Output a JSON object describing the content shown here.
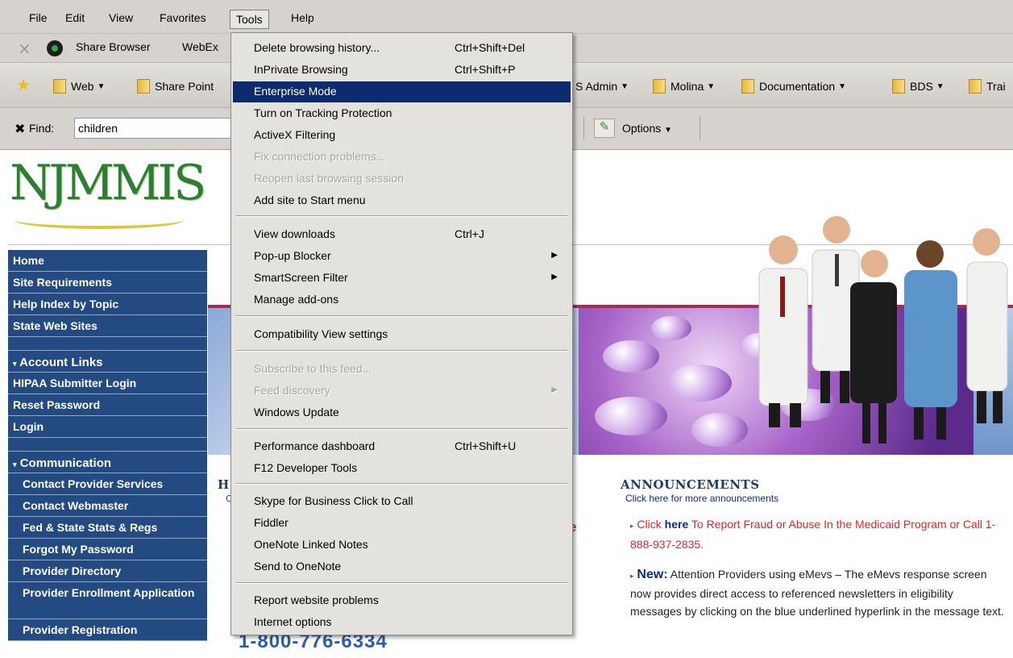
{
  "menubar": {
    "items": [
      "File",
      "Edit",
      "View",
      "Favorites",
      "Tools",
      "Help"
    ]
  },
  "toolbar1": {
    "share_browser": "Share Browser",
    "webex": "WebEx"
  },
  "favorites": {
    "web": "Web",
    "sharepoint": "Share Point",
    "s_admin": "S Admin",
    "molina": "Molina",
    "documentation": "Documentation",
    "bds": "BDS",
    "trai": "Trai"
  },
  "findbar": {
    "label": "Find:",
    "value": "children",
    "options": "Options"
  },
  "logo": {
    "text": "NJMMIS"
  },
  "leftnav": {
    "top_items": [
      "Home",
      "Site Requirements",
      "Help Index by Topic",
      "State Web Sites"
    ],
    "account_header": "Account Links",
    "account_items": [
      "HIPAA Submitter Login",
      "Reset Password",
      "Login"
    ],
    "communication_header": "Communication",
    "communication_items": [
      "Contact Provider Services",
      "Contact Webmaster",
      "Fed & State Stats & Regs",
      "Forgot My Password",
      "Provider Directory",
      "Provider Enrollment Application",
      "Provider Registration"
    ]
  },
  "content": {
    "mid_heading": "H",
    "mid_sub": "C",
    "mid_red": "e",
    "phone": "1-800-776-6334"
  },
  "announcements": {
    "title": "ANNOUNCEMENTS",
    "sub": "Click here for more announcements",
    "fraud_click": "Click",
    "fraud_here": "here",
    "fraud_text": "To Report Fraud or Abuse In the Medicaid Program or Call 1-888-937-2835.",
    "new_label": "New:",
    "new_text": "Attention Providers using eMevs – The eMevs response screen now provides direct access to referenced newsletters in eligibility messages by clicking on the blue underlined hyperlink in the message text."
  },
  "tools_menu": {
    "items": [
      {
        "label": "Delete browsing history...",
        "shortcut": "Ctrl+Shift+Del"
      },
      {
        "label": "InPrivate Browsing",
        "shortcut": "Ctrl+Shift+P"
      },
      {
        "label": "Enterprise Mode",
        "shortcut": ""
      },
      {
        "label": "Turn on Tracking Protection",
        "shortcut": ""
      },
      {
        "label": "ActiveX Filtering",
        "shortcut": ""
      },
      {
        "label": "Fix connection problems...",
        "shortcut": ""
      },
      {
        "label": "Reopen last browsing session",
        "shortcut": ""
      },
      {
        "label": "Add site to Start menu",
        "shortcut": ""
      },
      {
        "label": "View downloads",
        "shortcut": "Ctrl+J"
      },
      {
        "label": "Pop-up Blocker",
        "shortcut": ""
      },
      {
        "label": "SmartScreen Filter",
        "shortcut": ""
      },
      {
        "label": "Manage add-ons",
        "shortcut": ""
      },
      {
        "label": "Compatibility View settings",
        "shortcut": ""
      },
      {
        "label": "Subscribe to this feed...",
        "shortcut": ""
      },
      {
        "label": "Feed discovery",
        "shortcut": ""
      },
      {
        "label": "Windows Update",
        "shortcut": ""
      },
      {
        "label": "Performance dashboard",
        "shortcut": "Ctrl+Shift+U"
      },
      {
        "label": "F12 Developer Tools",
        "shortcut": ""
      },
      {
        "label": "Skype for Business Click to Call",
        "shortcut": ""
      },
      {
        "label": "Fiddler",
        "shortcut": ""
      },
      {
        "label": "OneNote Linked Notes",
        "shortcut": ""
      },
      {
        "label": "Send to OneNote",
        "shortcut": ""
      },
      {
        "label": "Report website problems",
        "shortcut": ""
      },
      {
        "label": "Internet options",
        "shortcut": ""
      }
    ]
  },
  "colors": {
    "nav_blue": "#244a82",
    "menu_highlight": "#0c2a6e",
    "alert_red": "#e0262a",
    "link_blue": "#102a8a"
  }
}
